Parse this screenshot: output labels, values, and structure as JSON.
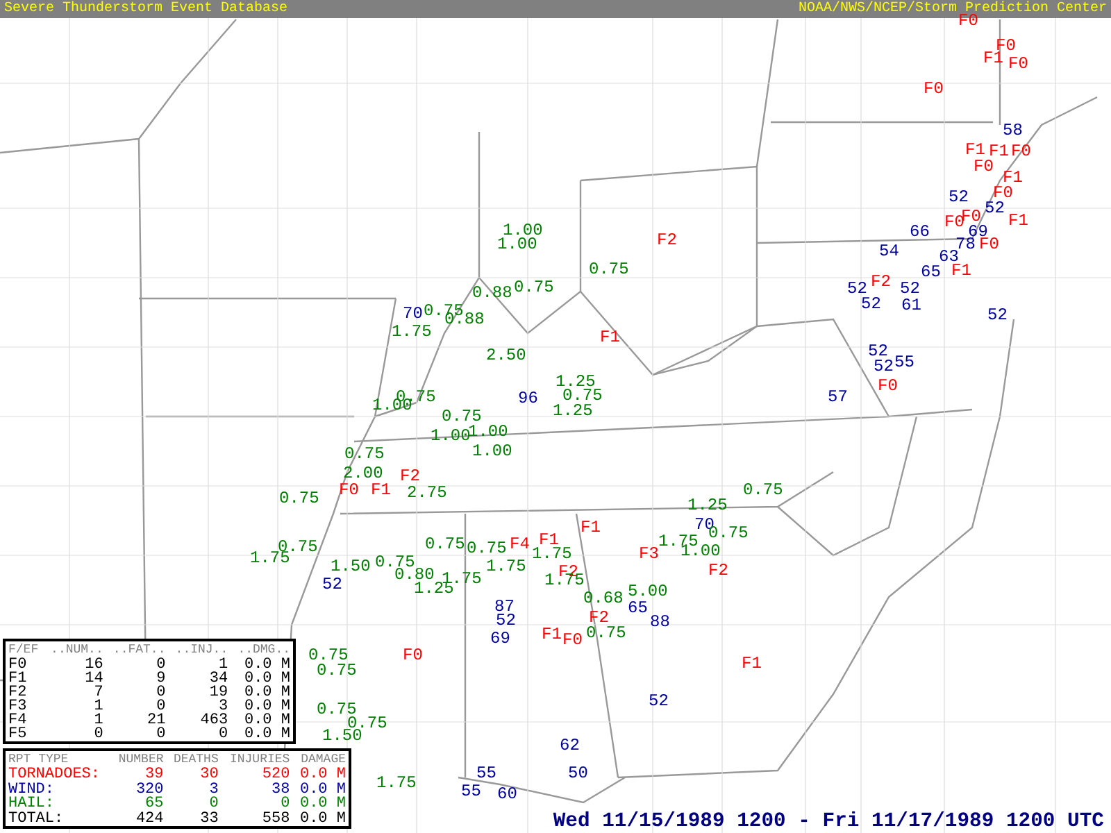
{
  "header": {
    "title": "Severe Thunderstorm Event Database",
    "credit": "NOAA/NWS/NCEP/Storm Prediction Center"
  },
  "map": {
    "reports": [
      {
        "text": "F0",
        "kind": "tornado"
      },
      {
        "text": "F1",
        "kind": "tornado"
      },
      {
        "text": "F0",
        "kind": "tornado"
      },
      {
        "text": "F0",
        "kind": "tornado"
      },
      {
        "text": "F0",
        "kind": "tornado"
      },
      {
        "text": "58",
        "kind": "wind"
      },
      {
        "text": "F1",
        "kind": "tornado"
      },
      {
        "text": "F1",
        "kind": "tornado"
      },
      {
        "text": "F0",
        "kind": "tornado"
      },
      {
        "text": "F0",
        "kind": "tornado"
      },
      {
        "text": "F1",
        "kind": "tornado"
      },
      {
        "text": "F0",
        "kind": "tornado"
      },
      {
        "text": "52",
        "kind": "wind"
      },
      {
        "text": "52",
        "kind": "wind"
      },
      {
        "text": "F0",
        "kind": "tornado"
      },
      {
        "text": "F1",
        "kind": "tornado"
      },
      {
        "text": "66",
        "kind": "wind"
      },
      {
        "text": "69",
        "kind": "wind"
      },
      {
        "text": "F0",
        "kind": "tornado"
      },
      {
        "text": "78",
        "kind": "wind"
      },
      {
        "text": "F0",
        "kind": "tornado"
      },
      {
        "text": "54",
        "kind": "wind"
      },
      {
        "text": "63",
        "kind": "wind"
      },
      {
        "text": "F1",
        "kind": "tornado"
      },
      {
        "text": "F2",
        "kind": "tornado"
      },
      {
        "text": "65",
        "kind": "wind"
      },
      {
        "text": "52",
        "kind": "wind"
      },
      {
        "text": "52",
        "kind": "wind"
      },
      {
        "text": "52",
        "kind": "wind"
      },
      {
        "text": "61",
        "kind": "wind"
      },
      {
        "text": "52",
        "kind": "wind"
      },
      {
        "text": "52",
        "kind": "wind"
      },
      {
        "text": "52",
        "kind": "wind"
      },
      {
        "text": "55",
        "kind": "wind"
      },
      {
        "text": "F0",
        "kind": "tornado"
      },
      {
        "text": "57",
        "kind": "wind"
      },
      {
        "text": "F2",
        "kind": "tornado"
      },
      {
        "text": "0.75",
        "kind": "hail"
      },
      {
        "text": "F1",
        "kind": "tornado"
      },
      {
        "text": "1.00",
        "kind": "hail"
      },
      {
        "text": "1.00",
        "kind": "hail"
      },
      {
        "text": "0.88",
        "kind": "hail"
      },
      {
        "text": "0.75",
        "kind": "hail"
      },
      {
        "text": "70",
        "kind": "wind"
      },
      {
        "text": "0.75",
        "kind": "hail"
      },
      {
        "text": "0.88",
        "kind": "hail"
      },
      {
        "text": "1.75",
        "kind": "hail"
      },
      {
        "text": "2.50",
        "kind": "hail"
      },
      {
        "text": "1.25",
        "kind": "hail"
      },
      {
        "text": "96",
        "kind": "wind"
      },
      {
        "text": "0.75",
        "kind": "hail"
      },
      {
        "text": "1.25",
        "kind": "hail"
      },
      {
        "text": "1.00",
        "kind": "hail"
      },
      {
        "text": "0.75",
        "kind": "hail"
      },
      {
        "text": "0.75",
        "kind": "hail"
      },
      {
        "text": "1.00",
        "kind": "hail"
      },
      {
        "text": "1.00",
        "kind": "hail"
      },
      {
        "text": "1.00",
        "kind": "hail"
      },
      {
        "text": "0.75",
        "kind": "hail"
      },
      {
        "text": "2.00",
        "kind": "hail"
      },
      {
        "text": "F0",
        "kind": "tornado"
      },
      {
        "text": "F1",
        "kind": "tornado"
      },
      {
        "text": "F2",
        "kind": "tornado"
      },
      {
        "text": "2.75",
        "kind": "hail"
      },
      {
        "text": "0.75",
        "kind": "hail"
      },
      {
        "text": "F1",
        "kind": "tornado"
      },
      {
        "text": "0.75",
        "kind": "hail"
      },
      {
        "text": "1.75",
        "kind": "hail"
      },
      {
        "text": "1.50",
        "kind": "hail"
      },
      {
        "text": "0.75",
        "kind": "hail"
      },
      {
        "text": "52",
        "kind": "wind"
      },
      {
        "text": "0.80",
        "kind": "hail"
      },
      {
        "text": "1.25",
        "kind": "hail"
      },
      {
        "text": "1.75",
        "kind": "hail"
      },
      {
        "text": "0.75",
        "kind": "hail"
      },
      {
        "text": "0.75",
        "kind": "hail"
      },
      {
        "text": "F4",
        "kind": "tornado"
      },
      {
        "text": "1.75",
        "kind": "hail"
      },
      {
        "text": "F1",
        "kind": "tornado"
      },
      {
        "text": "1.75",
        "kind": "hail"
      },
      {
        "text": "F2",
        "kind": "tornado"
      },
      {
        "text": "1.75",
        "kind": "hail"
      },
      {
        "text": "F3",
        "kind": "tornado"
      },
      {
        "text": "1.25",
        "kind": "hail"
      },
      {
        "text": "70",
        "kind": "wind"
      },
      {
        "text": "0.75",
        "kind": "hail"
      },
      {
        "text": "1.75",
        "kind": "hail"
      },
      {
        "text": "1.00",
        "kind": "hail"
      },
      {
        "text": "0.75",
        "kind": "hail"
      },
      {
        "text": "F2",
        "kind": "tornado"
      },
      {
        "text": "0.68",
        "kind": "hail"
      },
      {
        "text": "65",
        "kind": "wind"
      },
      {
        "text": "5.00",
        "kind": "hail"
      },
      {
        "text": "F2",
        "kind": "tornado"
      },
      {
        "text": "88",
        "kind": "wind"
      },
      {
        "text": "87",
        "kind": "wind"
      },
      {
        "text": "52",
        "kind": "wind"
      },
      {
        "text": "69",
        "kind": "wind"
      },
      {
        "text": "F1",
        "kind": "tornado"
      },
      {
        "text": "F0",
        "kind": "tornado"
      },
      {
        "text": "0.75",
        "kind": "hail"
      },
      {
        "text": "52",
        "kind": "wind"
      },
      {
        "text": "F1",
        "kind": "tornado"
      },
      {
        "text": "62",
        "kind": "wind"
      },
      {
        "text": "50",
        "kind": "wind"
      },
      {
        "text": "55",
        "kind": "wind"
      },
      {
        "text": "60",
        "kind": "wind"
      },
      {
        "text": "55",
        "kind": "wind"
      },
      {
        "text": "0.75",
        "kind": "hail"
      },
      {
        "text": "F0",
        "kind": "tornado"
      },
      {
        "text": "0.75",
        "kind": "hail"
      },
      {
        "text": "0.75",
        "kind": "hail"
      },
      {
        "text": "0.75",
        "kind": "hail"
      },
      {
        "text": "1.50",
        "kind": "hail"
      },
      {
        "text": "1.75",
        "kind": "hail"
      }
    ]
  },
  "fscale_table": {
    "columns": [
      "F/EF",
      "..NUM..",
      "..FAT..",
      "..INJ..",
      "..DMG.."
    ],
    "rows": [
      [
        "F0",
        "16",
        "0",
        "1",
        "0.0 M"
      ],
      [
        "F1",
        "14",
        "9",
        "34",
        "0.0 M"
      ],
      [
        "F2",
        "7",
        "0",
        "19",
        "0.0 M"
      ],
      [
        "F3",
        "1",
        "0",
        "3",
        "0.0 M"
      ],
      [
        "F4",
        "1",
        "21",
        "463",
        "0.0 M"
      ],
      [
        "F5",
        "0",
        "0",
        "0",
        "0.0 M"
      ]
    ]
  },
  "summary_table": {
    "columns": [
      "RPT TYPE",
      "NUMBER",
      "DEATHS",
      "INJURIES",
      "DAMAGE"
    ],
    "rows": [
      {
        "kind": "tornado",
        "cells": [
          "TORNADOES:",
          "39",
          "30",
          "520",
          "0.0 M"
        ]
      },
      {
        "kind": "wind",
        "cells": [
          "WIND:",
          "320",
          "3",
          "38",
          "0.0 M"
        ]
      },
      {
        "kind": "hail",
        "cells": [
          "HAIL:",
          "65",
          "0",
          "0",
          "0.0 M"
        ]
      },
      {
        "kind": "total",
        "cells": [
          "TOTAL:",
          "424",
          "33",
          "558",
          "0.0 M"
        ]
      }
    ]
  },
  "date_range": "Wed 11/15/1989 1200 - Fri 11/17/1989 1200 UTC"
}
